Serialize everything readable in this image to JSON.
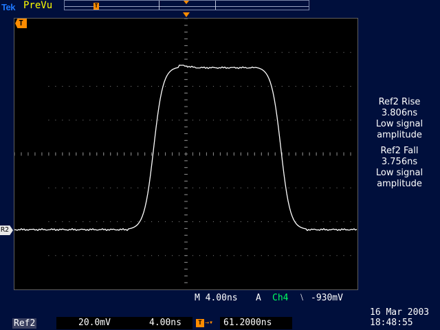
{
  "header": {
    "logo": "Tek",
    "acquisition_state": "PreVu"
  },
  "graticule": {
    "trigger_marker": "T",
    "ref_marker": "R2"
  },
  "measurements": [
    {
      "title": "Ref2 Rise",
      "value": "3.806ns",
      "note_line1": "Low signal",
      "note_line2": "amplitude"
    },
    {
      "title": "Ref2 Fall",
      "value": "3.756ns",
      "note_line1": "Low signal",
      "note_line2": "amplitude"
    }
  ],
  "horizontal": {
    "timebase": "M 4.00ns",
    "trigger_mode": "A",
    "trigger_source": "Ch4",
    "trigger_slope": "⧵",
    "trigger_level": "-930mV"
  },
  "reference": {
    "label": "Ref2",
    "vertical_scale": "20.0mV",
    "horizontal_scale": "4.00ns"
  },
  "trigger_offset": {
    "icon": "T",
    "value": "61.2000ns"
  },
  "clock": {
    "date": "16 Mar 2003",
    "time": "18:48:55"
  },
  "colors": {
    "background": "#000f3c",
    "graticule": "#000000",
    "trace": "#ffffff",
    "trigger": "#ff8c00",
    "channel4": "#00ff60",
    "logo": "#1e78ff",
    "acq_state": "#ffff00"
  }
}
